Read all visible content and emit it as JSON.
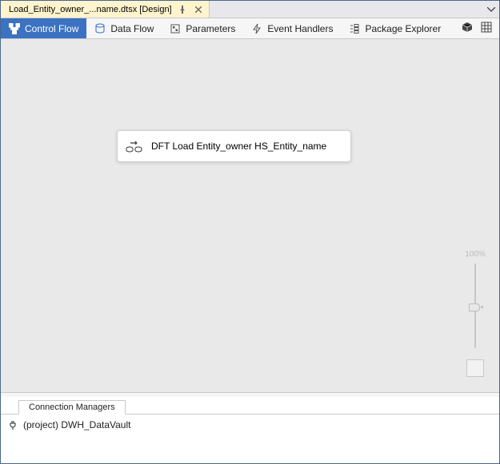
{
  "file_tab": {
    "title": "Load_Entity_owner_...name.dtsx [Design]"
  },
  "designer_tabs": {
    "control_flow": "Control Flow",
    "data_flow": "Data Flow",
    "parameters": "Parameters",
    "event_handlers": "Event Handlers",
    "package_explorer": "Package Explorer"
  },
  "task": {
    "label": "DFT Load Entity_owner HS_Entity_name"
  },
  "zoom": {
    "label": "100%"
  },
  "connection_managers": {
    "tab_label": "Connection Managers",
    "item_label": "(project) DWH_DataVault"
  }
}
